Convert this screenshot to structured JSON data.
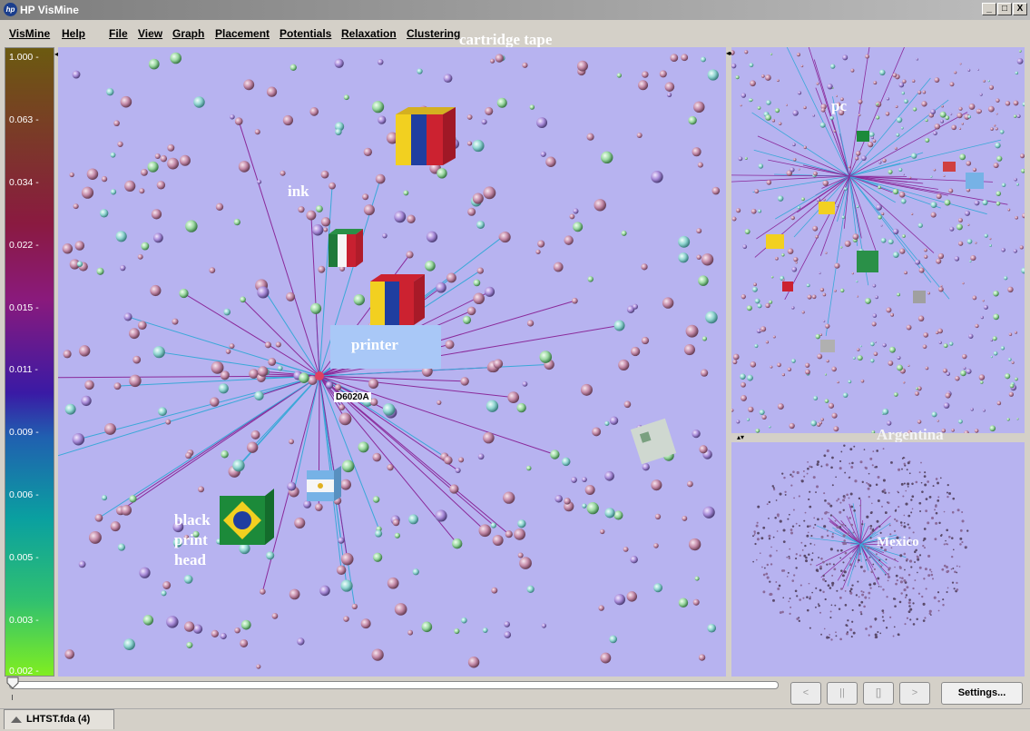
{
  "window": {
    "title": "HP VisMine",
    "logo_text": "hp",
    "minimize": "_",
    "maximize": "□",
    "close": "X"
  },
  "menus": [
    "VisMine",
    "Help",
    "File",
    "View",
    "Graph",
    "Placement",
    "Potentials",
    "Relaxation",
    "Clustering"
  ],
  "overlay_labels": {
    "cartridge_tape": "cartridge tape",
    "ink": "ink",
    "printer": "printer",
    "black_print_head": [
      "black",
      "print",
      "head"
    ],
    "pc": "pc",
    "argentina": "Argentina",
    "mexico": "Mexico"
  },
  "legend": {
    "ticks": [
      "1.000 -",
      "0.063 -",
      "0.034 -",
      "0.022 -",
      "0.015 -",
      "0.011 -",
      "0.009 -",
      "0.006 -",
      "0.005 -",
      "0.003 -",
      "0.002 -"
    ]
  },
  "main_view": {
    "selected_node": "D6020A"
  },
  "colors": {
    "background": "#b7b3f0",
    "edge_purple": "#8a2a9a",
    "edge_cyan": "#3aa8d8",
    "sphere_pink": "#c48aa8",
    "sphere_cyan": "#8fd4d0"
  },
  "controls": {
    "back": "<",
    "pause": "||",
    "stop": "[]",
    "play": ">",
    "settings": "Settings..."
  },
  "tab": {
    "label": "LHTST.fda (4)"
  }
}
